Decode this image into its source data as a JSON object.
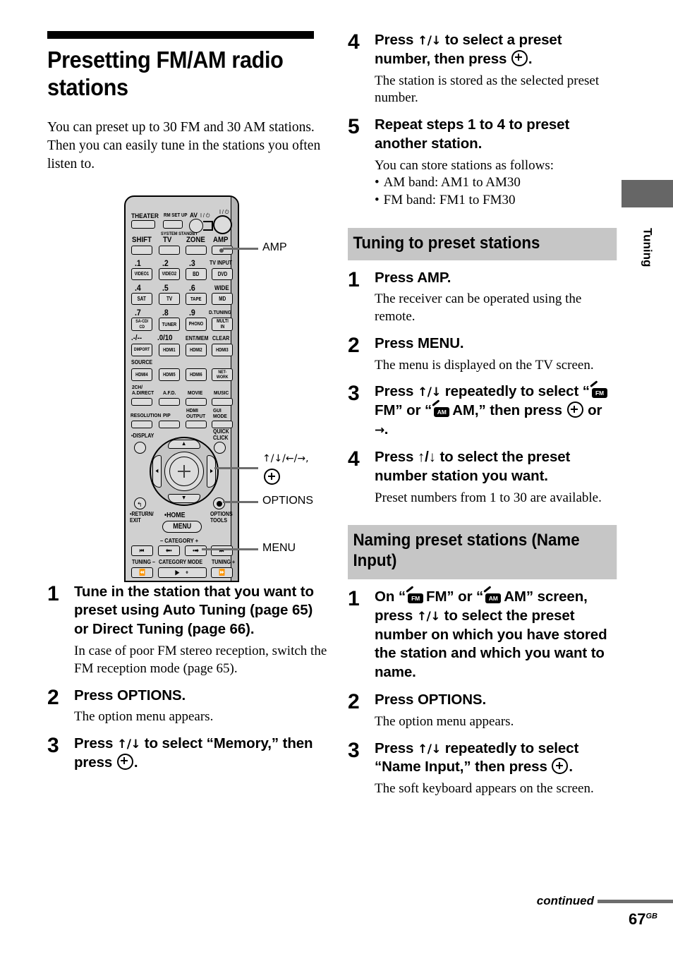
{
  "document": {
    "chapter_title": "Presetting FM/AM radio stations",
    "intro": "You can preset up to 30 FM and 30 AM stations. Then you can easily tune in the stations you often listen to.",
    "side_tab_label": "Tuning",
    "footer": {
      "continued": "continued",
      "page_number": "67",
      "page_suffix": "GB"
    },
    "colors": {
      "heading_band": "#c6c6c6",
      "side_tab_block": "#666666",
      "leader_line": "#6d6d6d",
      "remote_body": "#d0d0d0"
    }
  },
  "presetting_steps": [
    {
      "num": "1",
      "title_parts": [
        "Tune in the station that you want to preset using Auto Tuning (page 65) or Direct Tuning (page 66)."
      ],
      "desc": "In case of poor FM stereo reception, switch the FM reception mode (page 65)."
    },
    {
      "num": "2",
      "title_parts": [
        "Press OPTIONS."
      ],
      "desc": "The option menu appears."
    },
    {
      "num": "3",
      "title_parts": [
        "Press ",
        "ARROWS_UD",
        " to select “Memory,” then press ",
        "ENTER",
        "."
      ],
      "desc": ""
    },
    {
      "num": "4",
      "title_parts": [
        "Press ",
        "ARROWS_UD",
        " to select a preset number, then press ",
        "ENTER",
        "."
      ],
      "desc": "The station is stored as the selected preset number."
    },
    {
      "num": "5",
      "title_parts": [
        "Repeat steps 1 to 4 to preset another station."
      ],
      "desc": "You can store stations as follows:",
      "bullets": [
        "AM band: AM1 to AM30",
        "FM band: FM1 to FM30"
      ]
    }
  ],
  "section_tuning": {
    "heading": "Tuning to preset stations",
    "steps": [
      {
        "num": "1",
        "title": "Press AMP.",
        "desc": "The receiver can be operated using the remote."
      },
      {
        "num": "2",
        "title": "Press MENU.",
        "desc": "The menu is displayed on the TV screen."
      },
      {
        "num": "3",
        "title_pre": "Press ",
        "title_mid": " repeatedly to select “",
        "fm_label": "FM” or “",
        "am_label": "AM,” then press ",
        "title_end": " or ",
        "title_tail": ".",
        "desc": ""
      },
      {
        "num": "4",
        "title": "Press ↑/↓ to select the preset number station you want.",
        "desc": "Preset numbers from 1 to 30 are available."
      }
    ]
  },
  "section_naming": {
    "heading": "Naming preset stations (Name Input)",
    "steps": [
      {
        "num": "1",
        "desc": ""
      },
      {
        "num": "2",
        "title": "Press OPTIONS.",
        "desc": "The option menu appears."
      },
      {
        "num": "3",
        "desc": "The soft keyboard appears on the screen."
      }
    ]
  },
  "text_fragments": {
    "s3_on": "On “",
    "s3_fm": "FM” or “",
    "s3_am": "AM” screen, press ",
    "s3_rest": " to select the preset number on which you have stored the station and which you want to name.",
    "naming3_pre": "Press ",
    "naming3_post": " repeatedly to select “Name Input,” then press ",
    "naming3_end": ".",
    "tuning3_pre": "Press ",
    "tuning3_mid": " repeatedly to select “",
    "tuning3_fm": "FM” or “",
    "tuning3_am": "AM,” then press ",
    "tuning3_or": " or ",
    "tuning3_end": ".",
    "preset3_pre": "Press ",
    "preset3_post": " to select “Memory,” then press ",
    "preset3_end": ".",
    "preset4_pre": "Press ",
    "preset4_post": " to select a preset number, then press ",
    "preset4_end": ".",
    "arrows_ud": "↑/↓",
    "arrows_all": "↑/↓/←/→,",
    "arrow_right": "→"
  },
  "remote": {
    "callouts": [
      {
        "name": "amp",
        "label": "AMP"
      },
      {
        "name": "cursor",
        "label": "↑/↓/←/→,"
      },
      {
        "name": "options",
        "label": "OPTIONS"
      },
      {
        "name": "menu",
        "label": "MENU"
      }
    ],
    "top_labels": [
      "THEATER",
      "RM SET UP",
      "AV",
      "SYSTEM STANDBY"
    ],
    "power_glyph": "I / ⏻",
    "mode_row": [
      "SHIFT",
      "TV",
      "ZONE",
      "AMP"
    ],
    "numpad": [
      {
        "num": ".1",
        "btn": "VIDEO1"
      },
      {
        "num": ".2",
        "btn": "VIDEO2"
      },
      {
        "num": ".3",
        "btn": "BD"
      },
      {
        "num": "TV INPUT",
        "btn": "DVD"
      },
      {
        "num": ".4",
        "btn": "SAT"
      },
      {
        "num": ".5",
        "btn": "TV"
      },
      {
        "num": ".6",
        "btn": "TAPE"
      },
      {
        "num": "WIDE",
        "btn": "MD"
      },
      {
        "num": ".7",
        "btn": "SA-CD/ CD"
      },
      {
        "num": ".8",
        "btn": "TUNER"
      },
      {
        "num": ".9",
        "btn": "PHONO"
      },
      {
        "num": "D.TUNING",
        "btn": "MULTI IN"
      },
      {
        "num": ".-/--",
        "btn": "DMPORT"
      },
      {
        "num": ".0/10",
        "btn": "HDMI1"
      },
      {
        "num": "ENT/MEM",
        "btn": "HDMI2"
      },
      {
        "num": "CLEAR",
        "btn": "HDMI3"
      },
      {
        "num": "SOURCE",
        "btn": "HDMI4"
      },
      {
        "num": "",
        "btn": "HDMI5"
      },
      {
        "num": "",
        "btn": "HDMI6"
      },
      {
        "num": "",
        "btn": "NET- WORK"
      }
    ],
    "mode_labels_row1": [
      "2CH/ A.DIRECT",
      "A.F.D.",
      "MOVIE",
      "MUSIC"
    ],
    "mode_labels_row2": [
      "RESOLUTION",
      "PIP",
      "HDMI OUTPUT",
      "GUI MODE"
    ],
    "display_label": "DISPLAY",
    "quick_click_label": "QUICK CLICK",
    "return_label": "RETURN/ EXIT",
    "home_label": "HOME",
    "menu_label": "MENU",
    "options_tools_label": "OPTIONS TOOLS",
    "category_label": "– CATEGORY +",
    "tuning_minus": "TUNING –",
    "tuning_plus": "TUNING +",
    "category_mode": "CATEGORY MODE",
    "disc_skip": "DISC SKIP"
  }
}
